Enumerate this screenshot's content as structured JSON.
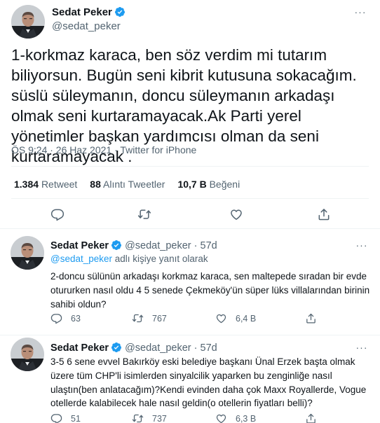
{
  "main_tweet": {
    "author_name": "Sedat Peker",
    "author_handle": "@sedat_peker",
    "text": "1-korkmaz karaca, ben söz verdim mi tutarım biliyorsun.  Bugün seni kibrit kutusuna sokacağım. süslü süleymanın, doncu süleymanın arkadaşı olmak seni kurtaramayacak.Ak Parti yerel yönetimler başkan yardımcısı olman da seni kurtaramayacak .",
    "time": "ÖS 9:24 · 26 Haz 2021 · Twitter for iPhone",
    "stats": {
      "retweets_count": "1.384",
      "retweets_label": "Retweet",
      "quotes_count": "88",
      "quotes_label": "Alıntı Tweetler",
      "likes_count": "10,7 B",
      "likes_label": "Beğeni"
    },
    "actions": [
      "reply-icon",
      "retweet-icon",
      "like-icon",
      "share-icon"
    ]
  },
  "replies": [
    {
      "author_name": "Sedat Peker",
      "author_handle": "@sedat_peker",
      "time": "57d",
      "reply_to_handle": "@sedat_peker",
      "reply_to_suffix": "adlı kişiye yanıt olarak",
      "text": "2-doncu sülünün arkadaşı korkmaz karaca, sen maltepede sıradan bir evde otururken nasıl oldu 4 5 senede Çekmeköy'ün süper lüks villalarından birinin sahibi oldun?",
      "replies_count": "63",
      "retweets_count": "767",
      "likes_count": "6,4 B"
    },
    {
      "author_name": "Sedat Peker",
      "author_handle": "@sedat_peker",
      "time": "57d",
      "text": "3-5 6 sene evvel Bakırköy eski belediye başkanı Ünal Erzek başta olmak üzere tüm CHP'li isimlerden sinyalcilik yaparken bu zenginliğe nasıl ulaştın(ben anlatacağım)?Kendi evinden daha çok Maxx Royallerde, Vogue otellerde kalabilecek hale nasıl geldin(o otellerin fiyatları belli)?",
      "replies_count": "51",
      "retweets_count": "737",
      "likes_count": "6,3 B"
    }
  ],
  "colors": {
    "text": "#0f1419",
    "muted": "#536471",
    "link": "#1d9bf0",
    "verified": "#1d9bf0",
    "divider": "#eff3f4"
  }
}
